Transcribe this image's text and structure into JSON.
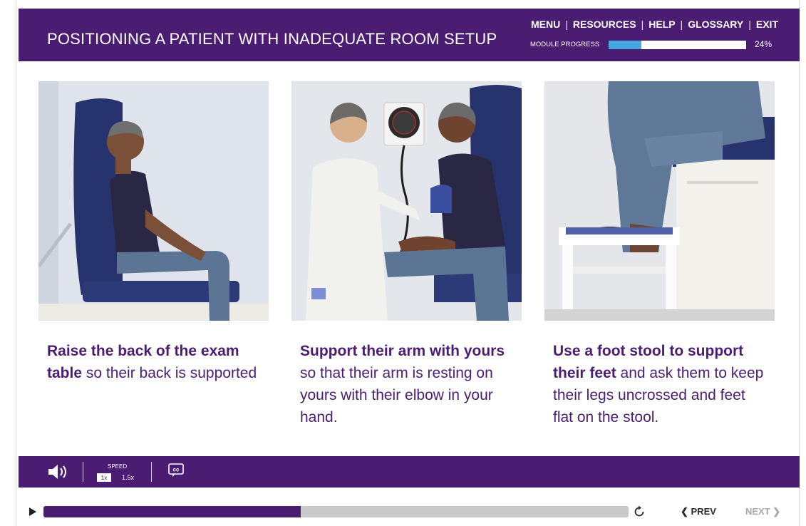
{
  "header": {
    "title": "POSITIONING A PATIENT WITH INADEQUATE ROOM SETUP",
    "menu": [
      "MENU",
      "RESOURCES",
      "HELP",
      "GLOSSARY",
      "EXIT"
    ],
    "progress_label": "MODULE PROGRESS",
    "progress_percent": "24%",
    "progress_fraction": 0.24
  },
  "panels": [
    {
      "bold": "Raise the back of the exam table",
      "rest": " so their back is supported"
    },
    {
      "bold": "Support their arm with yours",
      "rest": " so that their arm is resting on yours with their elbow in your hand."
    },
    {
      "bold": "Use a foot stool to support their feet",
      "rest": " and ask them to keep their legs uncrossed and feet flat on the stool."
    }
  ],
  "controls": {
    "speed_label": "SPEED",
    "speed_options": [
      "1x",
      "1.5x"
    ],
    "selected_speed": "1x",
    "volume_icon": "speaker-icon",
    "cc_icon": "closed-captions-icon"
  },
  "playback": {
    "progress_fraction": 0.44,
    "prev_label": "PREV",
    "next_label": "NEXT"
  },
  "colors": {
    "brand_purple": "#4b1d72",
    "progress_blue": "#45a7e0",
    "track_gray": "#c9c9c9",
    "disabled_text": "#a8a8a8"
  }
}
